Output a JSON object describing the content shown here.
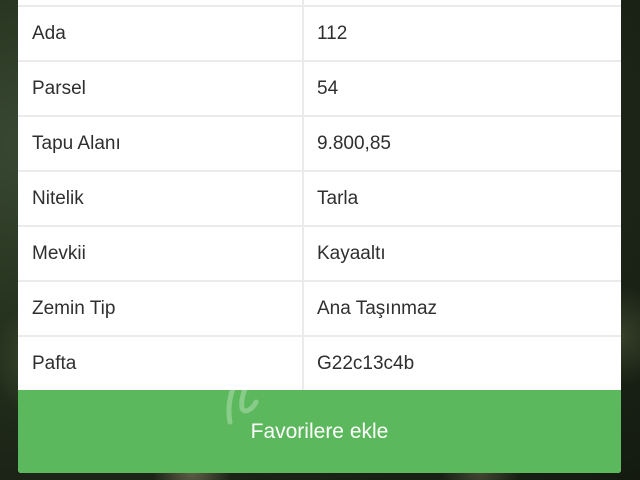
{
  "property_details": {
    "rows": [
      {
        "label": "Ada",
        "value": "112"
      },
      {
        "label": "Parsel",
        "value": "54"
      },
      {
        "label": "Tapu Alanı",
        "value": "9.800,85"
      },
      {
        "label": "Nitelik",
        "value": "Tarla"
      },
      {
        "label": "Mevkii",
        "value": "Kayaaltı"
      },
      {
        "label": "Zemin Tip",
        "value": "Ana Taşınmaz"
      },
      {
        "label": "Pafta",
        "value": "G22c13c4b"
      }
    ]
  },
  "actions": {
    "add_favorite_label": "Favorilere ekle"
  },
  "colors": {
    "button_green": "#5cb85c",
    "row_divider": "#ebebeb",
    "text": "#2f2f2f"
  },
  "icons": {
    "watermark": "watermark-logo"
  }
}
